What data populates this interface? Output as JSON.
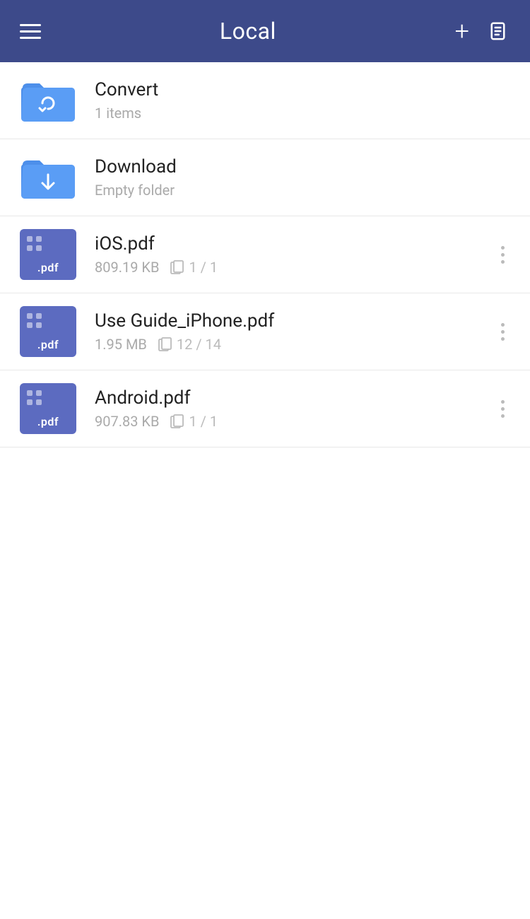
{
  "header": {
    "title": "Local",
    "add_label": "+",
    "menu_label": "menu",
    "edit_label": "edit"
  },
  "items": [
    {
      "type": "folder",
      "variant": "convert",
      "name": "Convert",
      "meta": "1 items",
      "has_more": false
    },
    {
      "type": "folder",
      "variant": "download",
      "name": "Download",
      "meta": "Empty folder",
      "has_more": false
    },
    {
      "type": "pdf",
      "name": "iOS.pdf",
      "size": "809.19 KB",
      "pages": "1 / 1",
      "has_more": true
    },
    {
      "type": "pdf",
      "name": "Use Guide_iPhone.pdf",
      "size": "1.95 MB",
      "pages": "12 / 14",
      "has_more": true
    },
    {
      "type": "pdf",
      "name": "Android.pdf",
      "size": "907.83 KB",
      "pages": "1 / 1",
      "has_more": true
    }
  ],
  "colors": {
    "header_bg": "#3d4a8a",
    "folder_blue": "#4d8fea",
    "pdf_purple": "#5c6bc0"
  }
}
